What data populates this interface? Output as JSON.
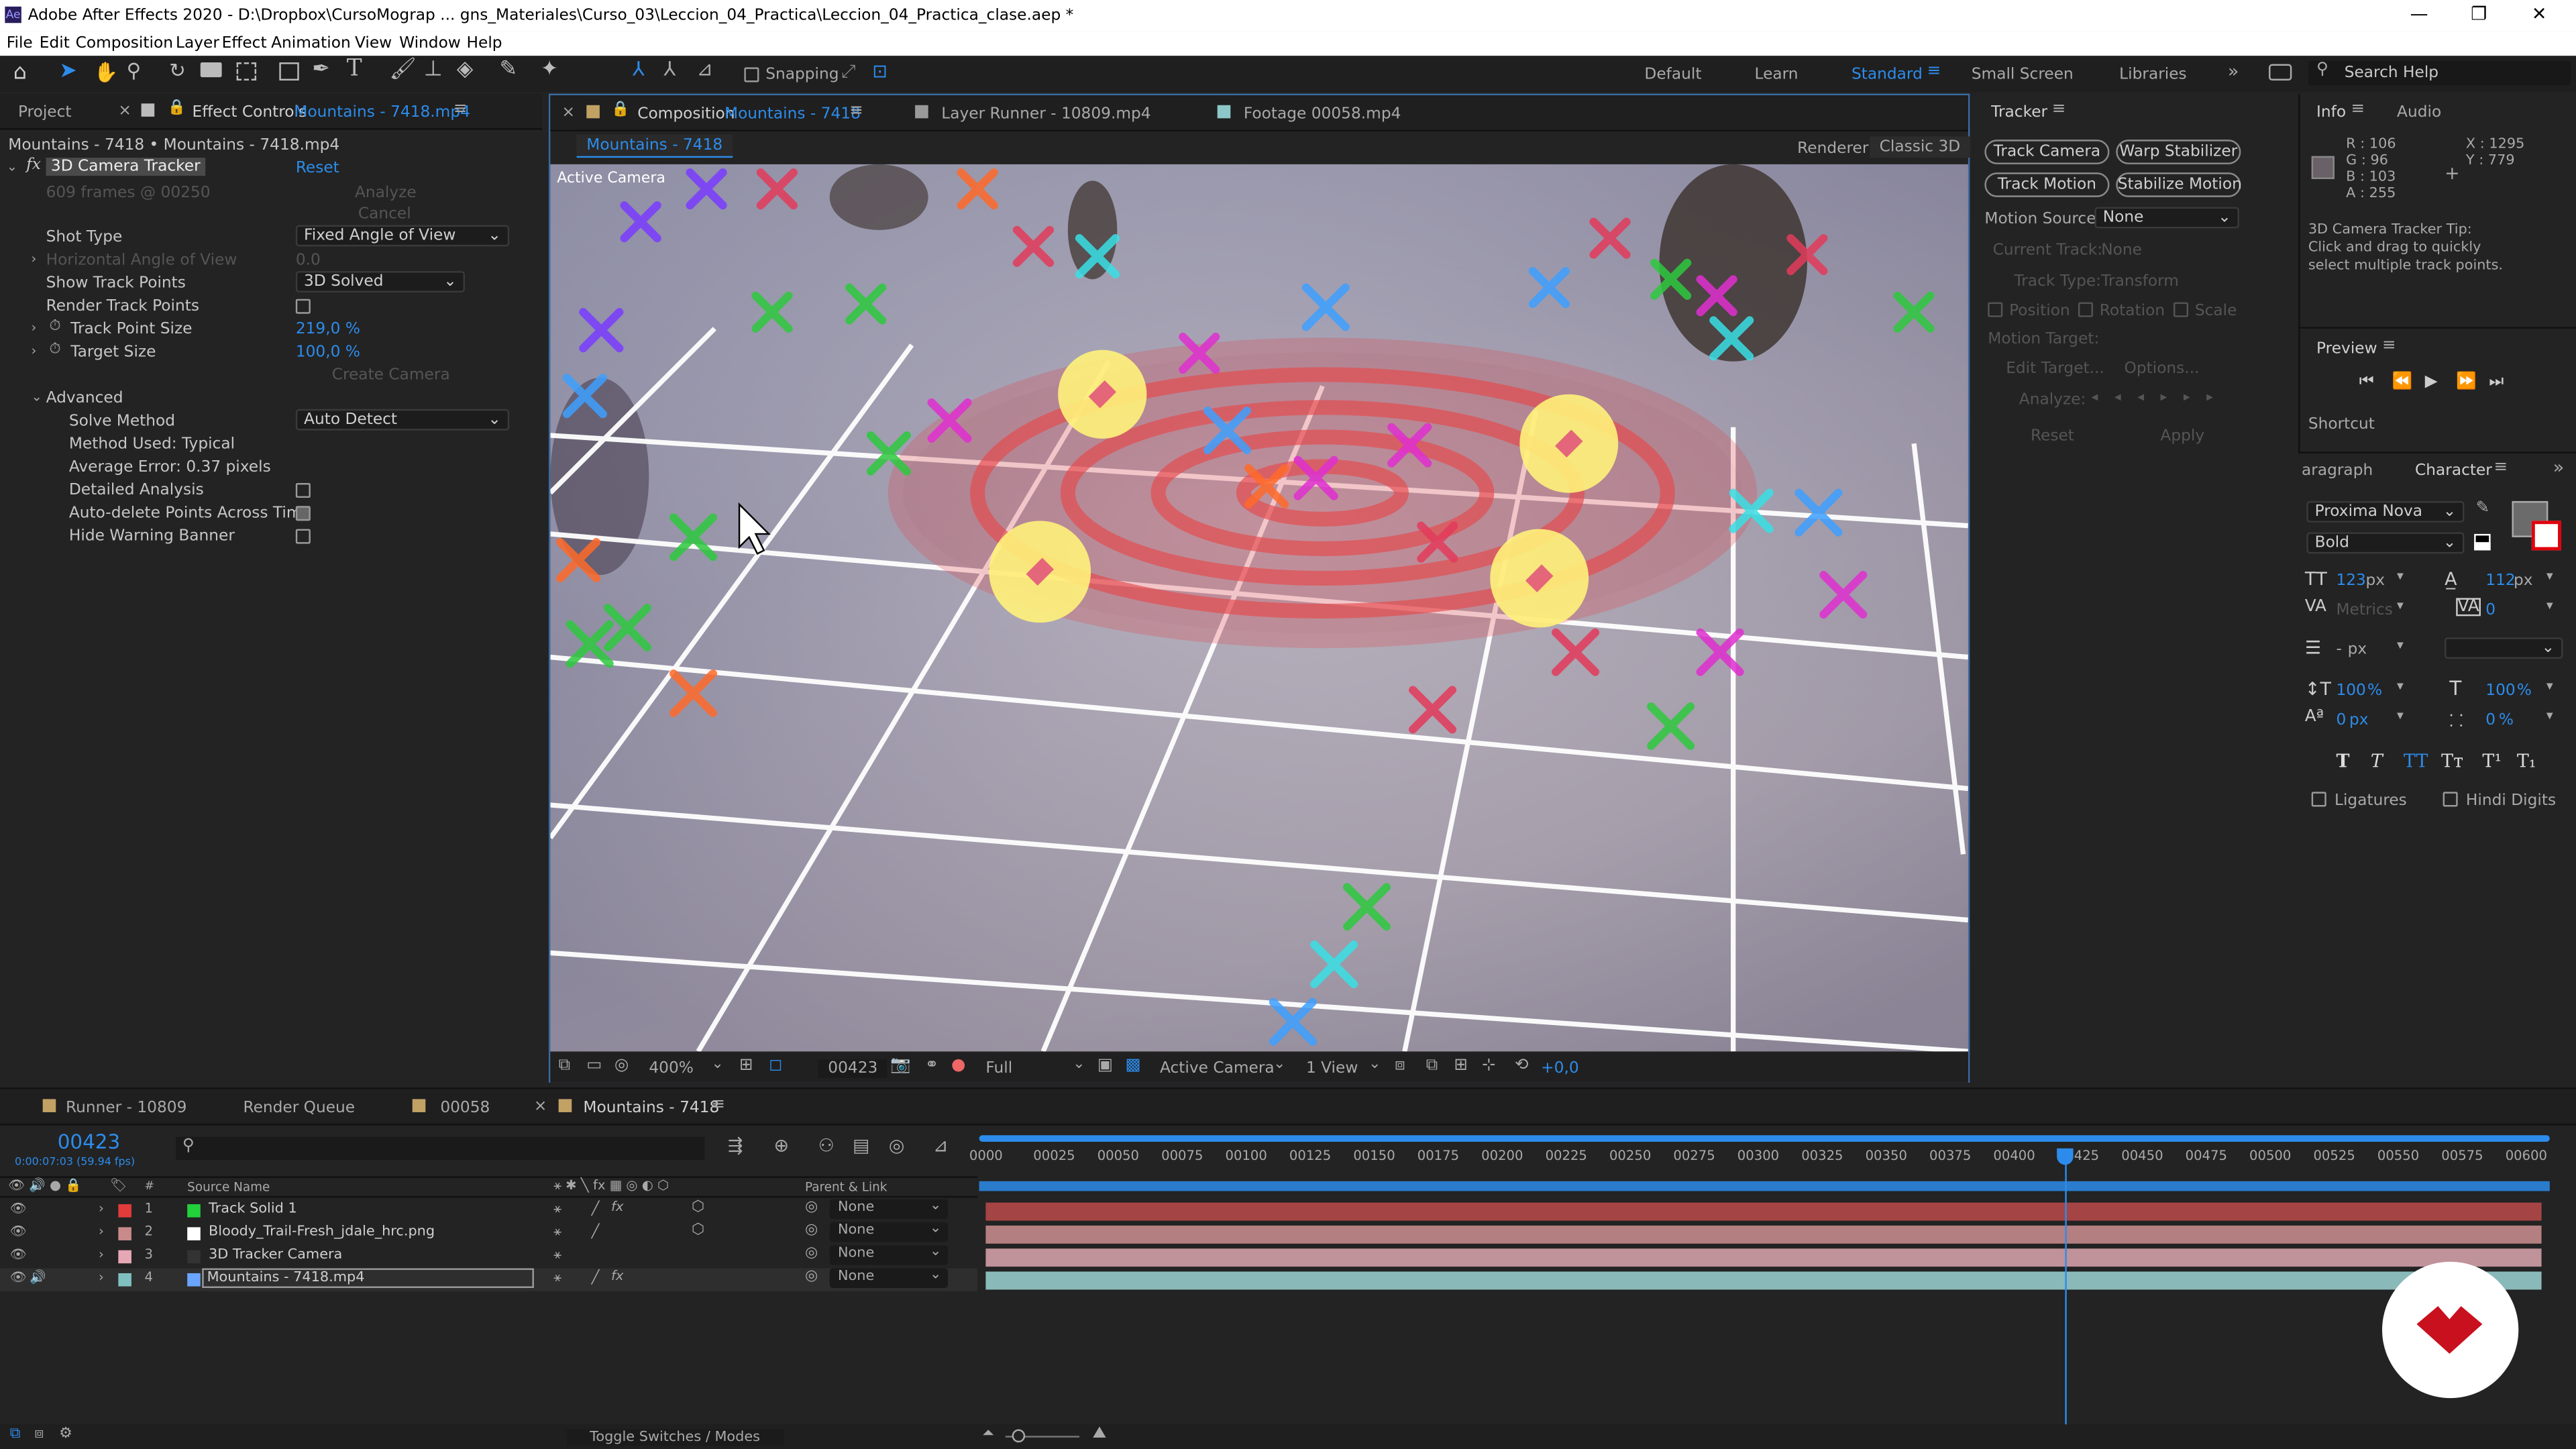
{
  "window": {
    "title": "Adobe After Effects 2020 - D:\\Dropbox\\CursoMograp ... gns_Materiales\\Curso_03\\Leccion_04_Practica\\Leccion_04_Practica_clase.aep *",
    "controls": [
      "—",
      "❐",
      "✕"
    ]
  },
  "menu": [
    "File",
    "Edit",
    "Composition",
    "Layer",
    "Effect",
    "Animation",
    "View",
    "Window",
    "Help"
  ],
  "toolbar": {
    "snapping_label": "Snapping",
    "workspaces": [
      "Default",
      "Learn",
      "Standard",
      "Small Screen",
      "Libraries"
    ],
    "active_workspace": "Standard",
    "search_placeholder": "Search Help"
  },
  "left_panel": {
    "tab_project": "Project",
    "tab_effect_controls": "Effect Controls",
    "tab_effect_target": "Mountains - 7418.mp4",
    "breadcrumb": "Mountains - 7418 • Mountains - 7418.mp4",
    "effect_name": "3D Camera Tracker",
    "reset": "Reset",
    "frames_info": "609 frames @ 00250",
    "analyze": "Analyze",
    "cancel": "Cancel",
    "props": [
      {
        "label": "Shot Type",
        "value": "Fixed Angle of View",
        "kind": "dropdown"
      },
      {
        "label": "Horizontal Angle of View",
        "value": "0.0",
        "kind": "dim"
      },
      {
        "label": "Show Track Points",
        "value": "3D Solved",
        "kind": "dropdown"
      },
      {
        "label": "Render Track Points",
        "value": "",
        "kind": "checkbox-off"
      },
      {
        "label": "Track Point Size",
        "value": "219,0 %",
        "kind": "blue"
      },
      {
        "label": "Target Size",
        "value": "100,0 %",
        "kind": "blue"
      },
      {
        "label": "",
        "value": "Create Camera",
        "kind": "dimbtn"
      }
    ],
    "advanced_label": "Advanced",
    "advanced": [
      {
        "label": "Solve Method",
        "value": "Auto Detect",
        "kind": "dropdown"
      },
      {
        "label": "Method Used: Typical",
        "value": "",
        "kind": "text"
      },
      {
        "label": "Average Error: 0.37 pixels",
        "value": "",
        "kind": "text"
      },
      {
        "label": "Detailed Analysis",
        "value": "",
        "kind": "checkbox-off"
      },
      {
        "label": "Auto-delete Points Across Time",
        "value": "",
        "kind": "checkbox-on"
      },
      {
        "label": "Hide Warning Banner",
        "value": "",
        "kind": "checkbox-off"
      }
    ]
  },
  "comp_panel": {
    "tab_comp_prefix": "Composition",
    "tab_comp_name": "Mountains - 7418",
    "tab_layer": "Layer  Runner - 10809.mp4",
    "tab_footage": "Footage  00058.mp4",
    "comp_chip": "Mountains - 7418",
    "renderer_label": "Renderer:",
    "renderer_value": "Classic 3D",
    "viewer_label": "Active Camera",
    "bottom": {
      "zoom": "400%",
      "timecode": "00423",
      "resolution": "Full",
      "camera": "Active Camera",
      "views": "1 View",
      "exposure": "+0,0"
    }
  },
  "tracker": {
    "title": "Tracker",
    "buttons": [
      "Track Camera",
      "Warp Stabilizer",
      "Track Motion",
      "Stabilize Motion"
    ],
    "motion_source_label": "Motion Source:",
    "motion_source_value": "None",
    "current_track_label": "Current Track:",
    "current_track_value": "None",
    "track_type_label": "Track Type:",
    "track_type_value": "Transform",
    "checks": [
      "Position",
      "Rotation",
      "Scale"
    ],
    "motion_target": "Motion Target:",
    "edit_target": "Edit Target...",
    "options": "Options...",
    "analyze": "Analyze:",
    "reset": "Reset",
    "apply": "Apply"
  },
  "info": {
    "tab_info": "Info",
    "tab_audio": "Audio",
    "r": "R : 106",
    "g": "G : 96",
    "b": "B : 103",
    "a": "A : 255",
    "x": "X : 1295",
    "y": "Y : 779",
    "tip": [
      "3D Camera Tracker Tip:",
      "Click and drag to quickly",
      "select multiple track points."
    ],
    "preview": "Preview",
    "shortcut": "Shortcut",
    "color_swatch": "#6a6067"
  },
  "character": {
    "tab_paragraph": "aragraph",
    "tab_character": "Character",
    "font": "Proxima Nova",
    "style": "Bold",
    "size": "123",
    "size_unit": "px",
    "leading": "112",
    "leading_unit": "px",
    "kerning": "Metrics",
    "tracking": "0",
    "stroke": "-",
    "stroke_unit": "px",
    "vscale": "100",
    "hscale": "100",
    "baseline": "0",
    "baseline_unit": "px",
    "tsume": "0",
    "percent": "%",
    "ligatures": "Ligatures",
    "hindi": "Hindi Digits",
    "styles": [
      "T",
      "T",
      "TT",
      "Tᴛ",
      "T¹",
      "T₁"
    ]
  },
  "timeline": {
    "tabs": [
      "Runner - 10809",
      "Render Queue",
      "00058",
      "Mountains - 7418"
    ],
    "active_tab": "Mountains - 7418",
    "timecode": "00423",
    "subtimecode": "0:00:07:03 (59.94 fps)",
    "search_placeholder": "",
    "col_source": "Source Name",
    "col_parent": "Parent & Link",
    "layers": [
      {
        "num": "1",
        "name": "Track Solid 1",
        "color": "#e23b3b",
        "icon": "#23d13b",
        "parent": "None",
        "bar": "#a54444"
      },
      {
        "num": "2",
        "name": "Bloody_Trail-Fresh_jdale_hrc.png",
        "color": "#c98a8a",
        "icon": "#ffffff",
        "parent": "None",
        "bar": "#b47f80"
      },
      {
        "num": "3",
        "name": "3D Tracker Camera",
        "color": "#e7a8b5",
        "icon": "#333333",
        "parent": "None",
        "bar": "#c0929a"
      },
      {
        "num": "4",
        "name": "Mountains - 7418.mp4",
        "color": "#7fbfbf",
        "icon": "#6aa6ff",
        "parent": "None",
        "bar": "#8ab9b9"
      }
    ],
    "ruler": [
      "0000",
      "00025",
      "00050",
      "00075",
      "00100",
      "00125",
      "00150",
      "00175",
      "00200",
      "00225",
      "00250",
      "00275",
      "00300",
      "00325",
      "00350",
      "00375",
      "00400",
      "00425",
      "00450",
      "00475",
      "00500",
      "00525",
      "00550",
      "00575",
      "00600"
    ],
    "toggle": "Toggle Switches / Modes",
    "playhead_frame": 423,
    "total_frames": 609
  }
}
